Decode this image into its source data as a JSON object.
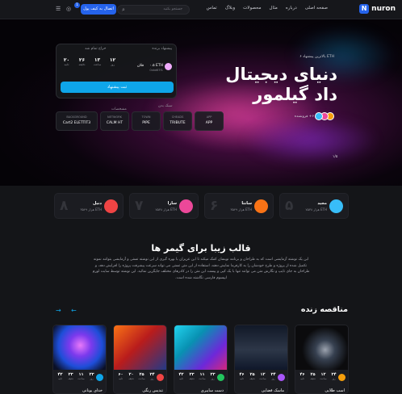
{
  "header": {
    "logo": "nuron",
    "nav": [
      "صفحه اصلی",
      "درباره",
      "مثال",
      "محصولات",
      "وبلاگ",
      "تماس"
    ],
    "search_placeholder": "جستجو بکنید",
    "wallet_button": "اتصال به کیف پول",
    "cart_count": "1"
  },
  "hero": {
    "by_line": "بالاترین پیشنهاد ۶ ETH",
    "title": "دنیای دیجیتال داد گیلمور",
    "owners_text": "۶+ فروشنده",
    "pager": "۱/۵",
    "bid_card": {
      "winner_label": "پیشنهاد برنده",
      "time_label": "حراج تمام شد",
      "winner_name": "فلان",
      "amount": "۰.۵ ETH",
      "address": "0xbd67f1",
      "timer": [
        {
          "n": "۱۲",
          "u": "روز"
        },
        {
          "n": "۱۳",
          "u": "ساعت"
        },
        {
          "n": "۲۶",
          "u": "دقیقه"
        },
        {
          "n": "۲۰",
          "u": "ثانیه"
        }
      ],
      "button": "ثبت پیشنهاد"
    },
    "specs_label": "مشخصات",
    "specs_label2": "سبک بدن",
    "specs": [
      {
        "k": "APP",
        "v": "APP"
      },
      {
        "k": "CHEADS",
        "v": "TRIBUTE"
      },
      {
        "k": "TOWN",
        "v": "PIPE"
      },
      {
        "k": "NETWORK",
        "v": "CALM HT"
      },
      {
        "k": "BACKGROUND",
        "v": "Cart2 ELETTIT3"
      }
    ]
  },
  "sellers": [
    {
      "name": "مجید",
      "eth": "۷۵۳۸ هزار ETH",
      "rank": "۵",
      "color": "#38bdf8"
    },
    {
      "name": "سانتا",
      "eth": "۳۵۴۹ هزار ETH",
      "rank": "۶",
      "color": "#f97316"
    },
    {
      "name": "سارا",
      "eth": "۷۵۳۸ هزار ETH",
      "rank": "۷",
      "color": "#ec4899"
    },
    {
      "name": "دنیل",
      "eth": "۳۵۴۹ هزار ETH",
      "rank": "۸",
      "color": "#ef4444"
    }
  ],
  "section": {
    "title": "قالب زیبا برای گیمر ها",
    "text": "این یک نوشته آزمایشی است که به طراحان و برنامه نویسان کمک میکند تا این عزیزان با بهره گیری از این نوشته تستی و آزمایشی بتوانند نمونه تکمیل شده از پروژه و طرح خودشان را به کارفرما نمایش دهند، استفاده از این متن تستی می تواند سرعت پیشرفت پروژه را افزایش دهد، و طراحان به جای تایپ و نگارش متن می توانند تنها با یک کپی و پیست این متن را در کادرهای مختلف جایگزین نمائید. این نوشته توسط سایت لورم ایپسوم فارسی نگاشته شده است."
  },
  "live": {
    "title": "مناقصه زنده",
    "cards": [
      {
        "name": "اسب طلایی",
        "timer": [
          "۴۶",
          "۲۵",
          "۱۲",
          "۲۴"
        ]
      },
      {
        "name": "ماسک فضایی",
        "timer": [
          "۴۶",
          "۲۵",
          "۱۲",
          "۲۴"
        ]
      },
      {
        "name": "دست سایبری",
        "timer": [
          "۴۲",
          "۲۳",
          "۱۱",
          "۲۳"
        ]
      },
      {
        "name": "تندیس رنگی",
        "timer": [
          "۶۰",
          "۲۰",
          "۲۵",
          "۲۴"
        ]
      },
      {
        "name": "خدای یونانی",
        "timer": [
          "۴۲",
          "۲۳",
          "۱۱",
          "۲۳"
        ]
      }
    ],
    "timer_units": [
      "روز",
      "ساعت",
      "دقیقه",
      "ثانیه"
    ]
  }
}
